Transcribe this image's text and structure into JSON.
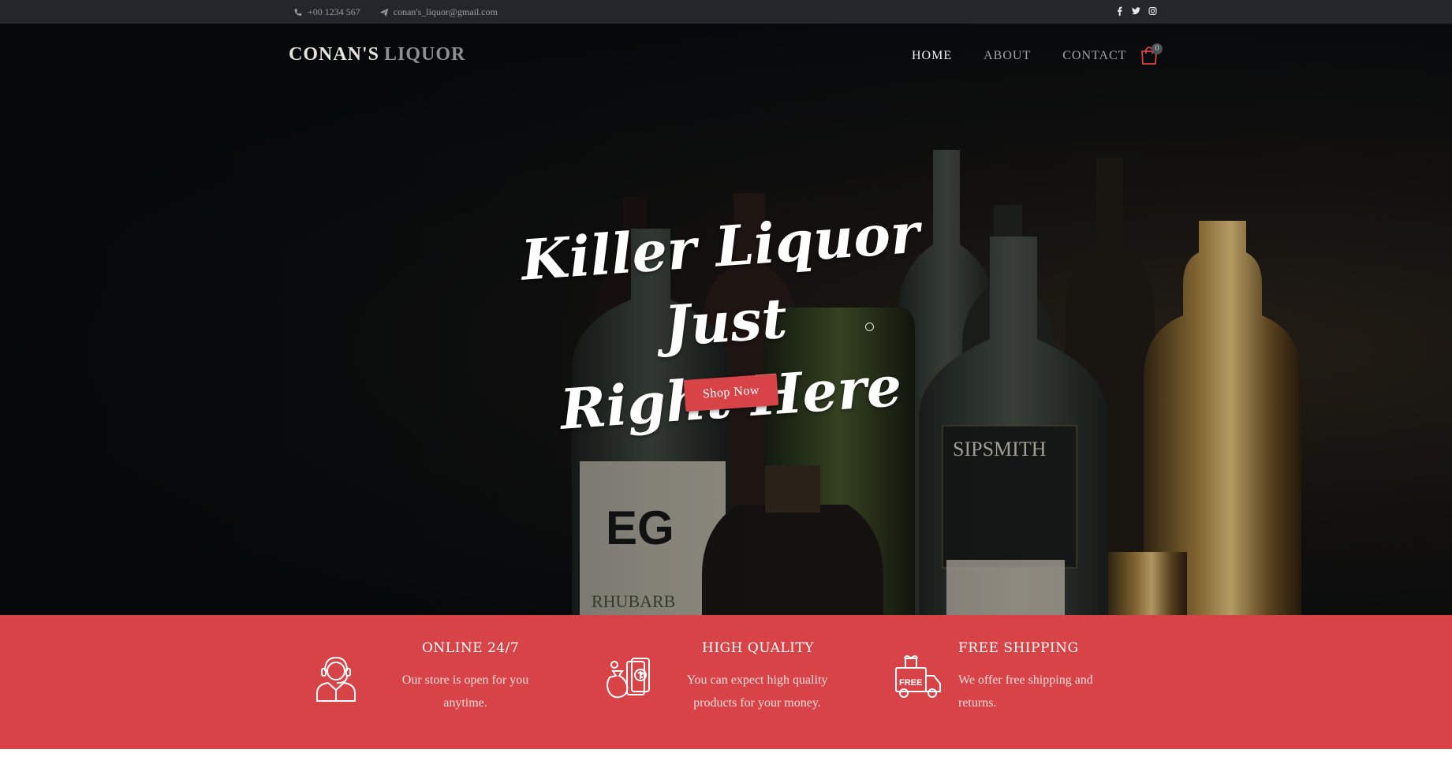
{
  "topbar": {
    "phone": "+00 1234 567",
    "email": "conan's_liquor@gmail.com",
    "social": [
      "facebook-icon",
      "twitter-icon",
      "instagram-icon"
    ]
  },
  "brand": {
    "first": "CONAN'S",
    "second": "LIQUOR"
  },
  "nav": {
    "items": [
      {
        "label": "HOME",
        "active": true
      },
      {
        "label": "ABOUT",
        "active": false
      },
      {
        "label": "CONTACT",
        "active": false
      }
    ],
    "cart_count": "0"
  },
  "hero": {
    "headline_line1": "Killer Liquor Just",
    "headline_line2": "Right Here",
    "cta_label": "Shop Now"
  },
  "features": [
    {
      "icon": "customer-support-icon",
      "title": "ONLINE 24/7",
      "desc": "Our store is open for you anytime."
    },
    {
      "icon": "money-bag-icon",
      "title": "HIGH QUALITY",
      "desc": "You can expect high quality products for your money."
    },
    {
      "icon": "free-shipping-truck-icon",
      "title": "FREE SHIPPING",
      "desc": "We offer free shipping and returns."
    }
  ],
  "colors": {
    "accent": "#d74347",
    "topbar_bg": "#23272c",
    "hero_bg": "#07090b"
  }
}
